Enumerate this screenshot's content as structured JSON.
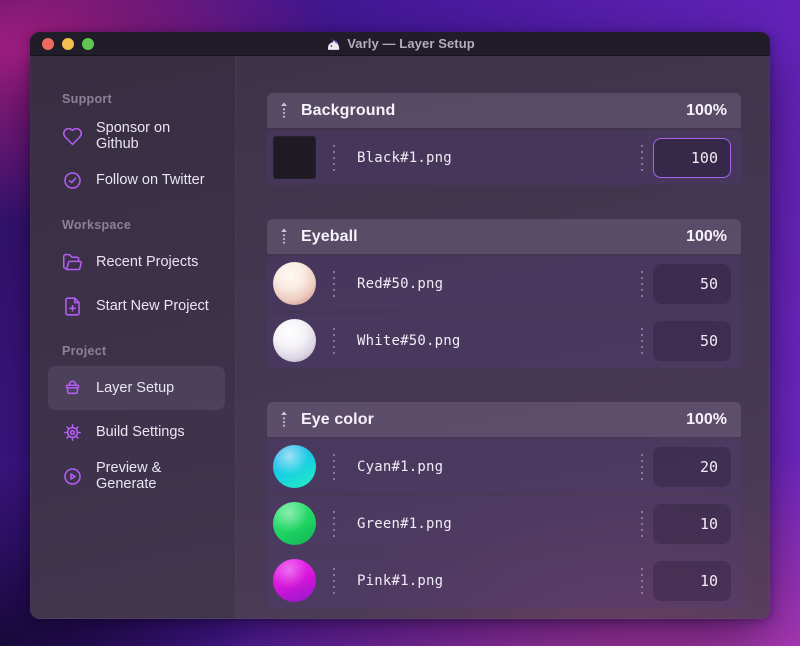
{
  "window": {
    "title": "Varly — Layer Setup",
    "app_icon": "unicorn-icon"
  },
  "traffic_lights": {
    "close_color": "#ed6a5e",
    "minimize_color": "#f4bf4f",
    "zoom_color": "#61c554"
  },
  "sidebar": {
    "sections": [
      {
        "label": "Support",
        "items": [
          {
            "label": "Sponsor on Github",
            "icon": "heart-icon"
          },
          {
            "label": "Follow on Twitter",
            "icon": "badge-check-icon"
          }
        ]
      },
      {
        "label": "Workspace",
        "items": [
          {
            "label": "Recent Projects",
            "icon": "folder-open-icon"
          },
          {
            "label": "Start New Project",
            "icon": "file-plus-icon"
          }
        ]
      },
      {
        "label": "Project",
        "items": [
          {
            "label": "Layer Setup",
            "icon": "layers-basket-icon",
            "active": true
          },
          {
            "label": "Build Settings",
            "icon": "gear-icon"
          },
          {
            "label": "Preview & Generate",
            "icon": "play-circle-icon"
          }
        ]
      }
    ]
  },
  "main": {
    "groups": [
      {
        "name": "Background",
        "opacity": "100%",
        "layers": [
          {
            "file": "Black#1.png",
            "value": "100",
            "thumb": "black-square-thumbnail",
            "focused": true
          }
        ]
      },
      {
        "name": "Eyeball",
        "opacity": "100%",
        "layers": [
          {
            "file": "Red#50.png",
            "value": "50",
            "thumb": "red-sphere-thumbnail"
          },
          {
            "file": "White#50.png",
            "value": "50",
            "thumb": "white-sphere-thumbnail"
          }
        ]
      },
      {
        "name": "Eye color",
        "opacity": "100%",
        "layers": [
          {
            "file": "Cyan#1.png",
            "value": "20",
            "thumb": "cyan-sphere-thumbnail"
          },
          {
            "file": "Green#1.png",
            "value": "10",
            "thumb": "green-sphere-thumbnail"
          },
          {
            "file": "Pink#1.png",
            "value": "10",
            "thumb": "pink-sphere-thumbnail"
          }
        ]
      }
    ]
  },
  "colors": {
    "accent_purple": "#b45cf3",
    "focus_border": "#a964ef",
    "window_bg": "#443753",
    "titlebar_bg": "#211d28"
  }
}
